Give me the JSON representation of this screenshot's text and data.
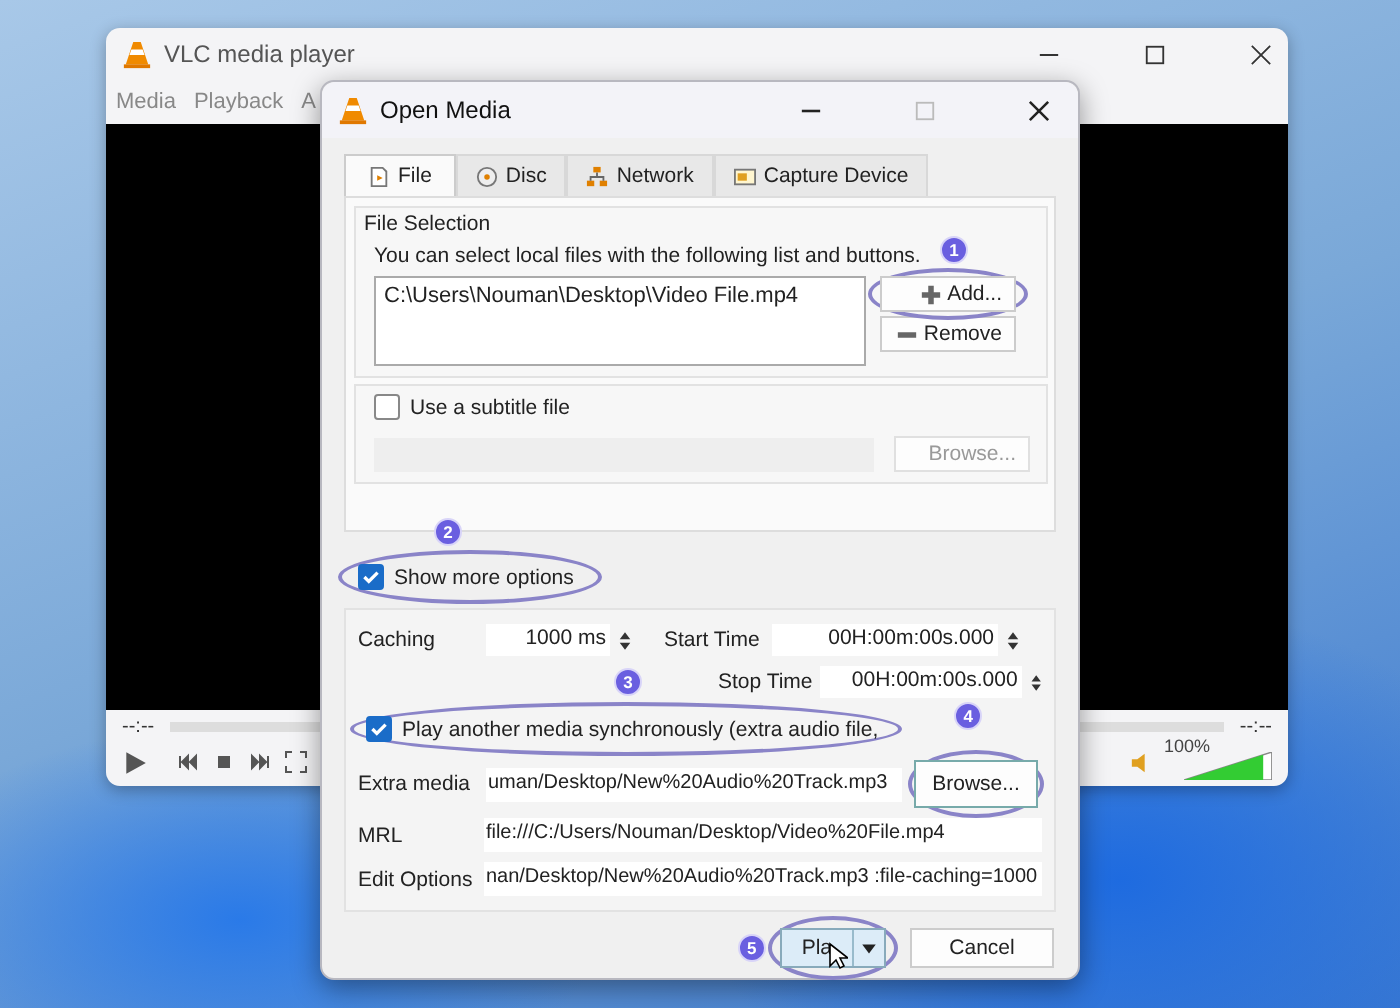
{
  "vlc_window": {
    "title": "VLC media player",
    "menu": [
      "Media",
      "Playback",
      "A"
    ],
    "elapsed": "--:--",
    "remaining": "--:--",
    "volume": {
      "level": 0.9,
      "reading": "100%"
    }
  },
  "dialog": {
    "title": "Open Media",
    "tabs": [
      {
        "label": "File",
        "kind": "file",
        "selected": true
      },
      {
        "label": "Disc",
        "kind": "disc",
        "selected": false
      },
      {
        "label": "Network",
        "kind": "network",
        "selected": false
      },
      {
        "label": "Capture Device",
        "kind": "capture",
        "selected": false
      }
    ],
    "file_selection": {
      "title": "File Selection",
      "hint": "You can select local files with the following list and buttons.",
      "files": [
        "C:\\Users\\Nouman\\Desktop\\Video File.mp4"
      ],
      "add_button": "Add...",
      "remove_button": "Remove"
    },
    "subtitle": {
      "label": "Use a subtitle file",
      "checked": false,
      "disabled": true,
      "browse_button": "Browse..."
    },
    "show_more": {
      "label": "Show more options",
      "checked": true
    },
    "options": {
      "caching": {
        "label": "Caching",
        "value": "1000 ms"
      },
      "start_time": {
        "label": "Start Time",
        "value": "00H:00m:00s.000"
      },
      "stop_time": {
        "label": "Stop Time",
        "value": "00H:00m:00s.000"
      },
      "sync": {
        "label": "Play another media synchronously (extra audio file,",
        "checked": true
      },
      "extra_media": {
        "label": "Extra media",
        "value": "uman/Desktop/New%20Audio%20Track.mp3",
        "browse_button": "Browse..."
      },
      "mrl": {
        "label": "MRL",
        "value": "file:///C:/Users/Nouman/Desktop/Video%20File.mp4"
      },
      "edit_options": {
        "label": "Edit Options",
        "value": "nan/Desktop/New%20Audio%20Track.mp3 :file-caching=1000"
      }
    },
    "play_button": "Pla",
    "cancel_button": "Cancel"
  },
  "annotations": [
    {
      "text": "1"
    },
    {
      "text": "2"
    },
    {
      "text": "3"
    },
    {
      "text": "4"
    },
    {
      "text": "5"
    }
  ]
}
